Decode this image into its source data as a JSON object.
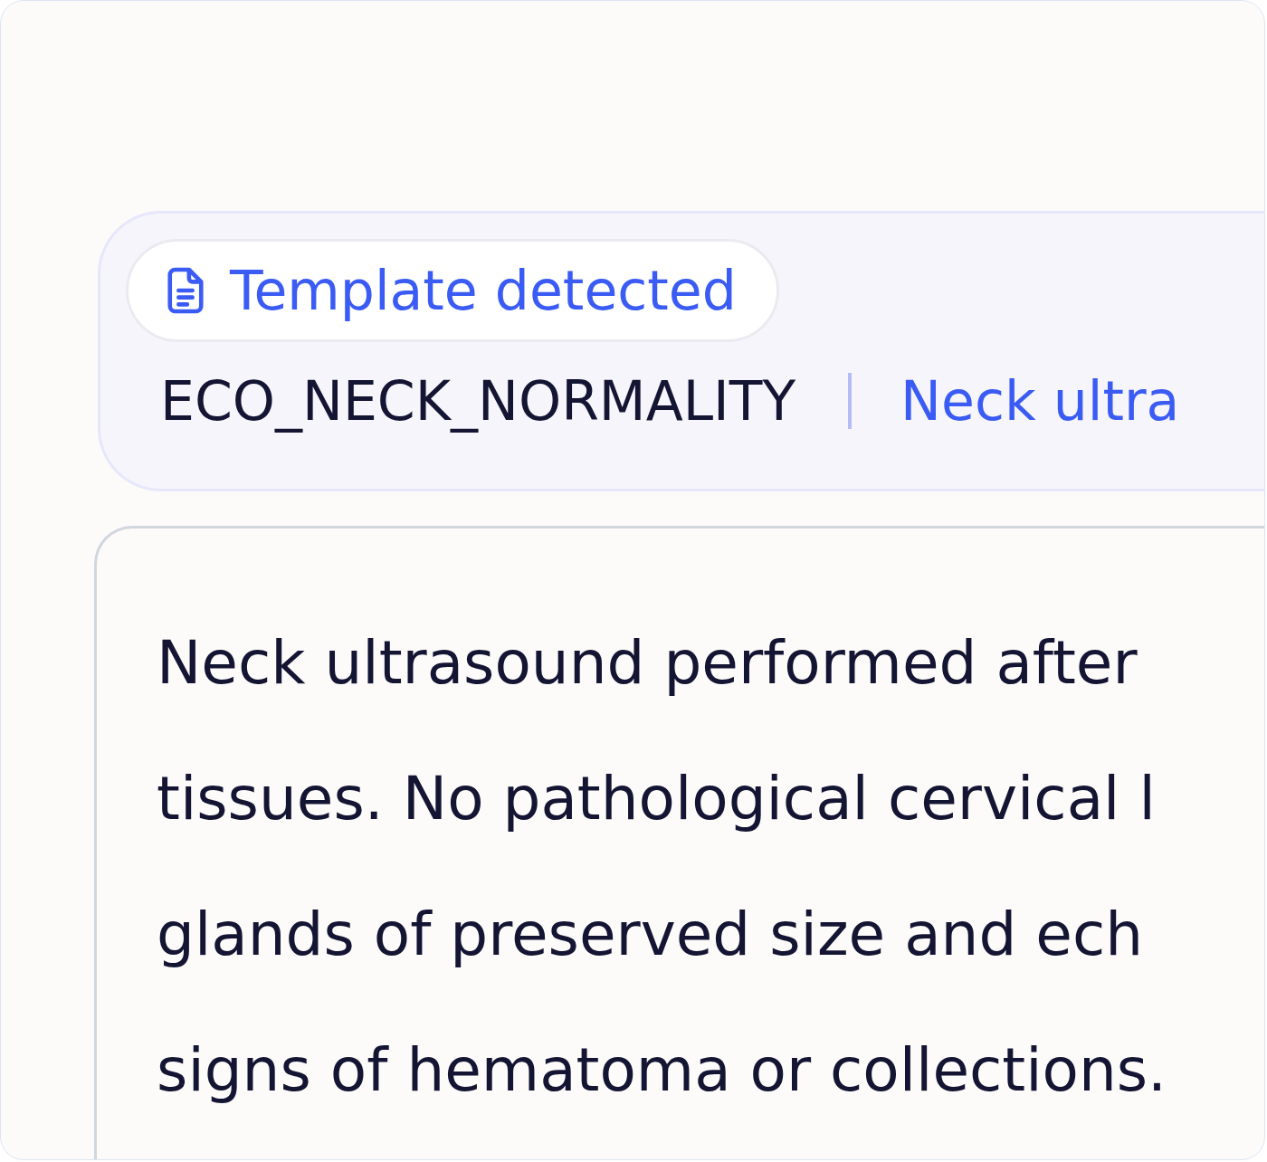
{
  "template_badge": {
    "label": "Template detected"
  },
  "template": {
    "code": "ECO_NECK_NORMALITY",
    "name": "Neck ultra"
  },
  "report": {
    "lines": [
      "Neck ultrasound performed after",
      "tissues. No pathological cervical l",
      "glands of preserved size and ech",
      "signs of hematoma or collections."
    ]
  }
}
